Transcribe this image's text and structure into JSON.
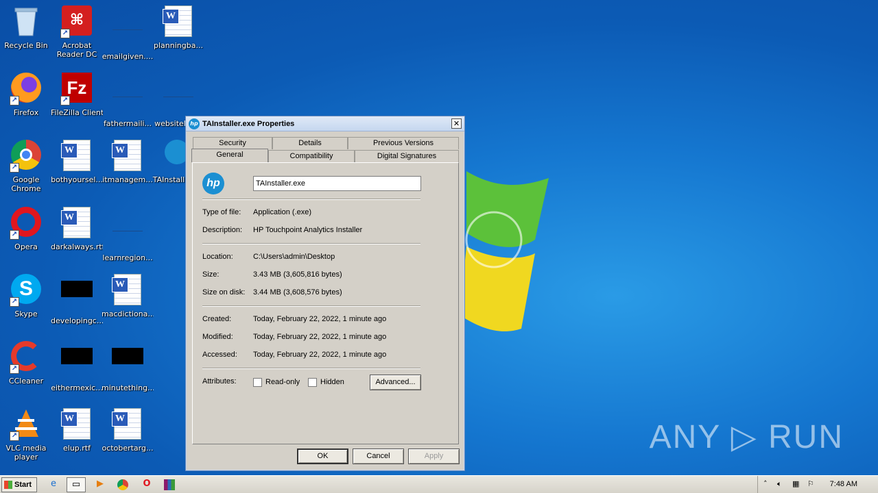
{
  "desktop": {
    "icons": [
      {
        "label": "Recycle Bin",
        "icon": "recycle-bin-icon"
      },
      {
        "label": "Acrobat Reader DC",
        "icon": "acrobat-reader-icon"
      },
      {
        "label": "emailgiven....",
        "icon": "blank-file-icon"
      },
      {
        "label": "planningba...",
        "icon": "word-document-icon"
      },
      {
        "label": "Firefox",
        "icon": "firefox-icon"
      },
      {
        "label": "FileZilla Client",
        "icon": "filezilla-icon"
      },
      {
        "label": "fathermaili...",
        "icon": "blank-file-icon"
      },
      {
        "label": "websitelea...",
        "icon": "blank-file-icon"
      },
      {
        "label": "Google Chrome",
        "icon": "chrome-icon"
      },
      {
        "label": "bothyoursel...",
        "icon": "word-document-icon"
      },
      {
        "label": "itmanagem...",
        "icon": "word-document-icon"
      },
      {
        "label": "TAInstall",
        "icon": "hp-installer-icon"
      },
      {
        "label": "Opera",
        "icon": "opera-icon"
      },
      {
        "label": "darkalways.rtf",
        "icon": "word-document-icon"
      },
      {
        "label": "learnregion...",
        "icon": "blank-file-icon"
      },
      {
        "label": "Skype",
        "icon": "skype-icon"
      },
      {
        "label": "developingc...",
        "icon": "black-file-icon"
      },
      {
        "label": "macdictiona...",
        "icon": "word-document-icon"
      },
      {
        "label": "CCleaner",
        "icon": "ccleaner-icon"
      },
      {
        "label": "eithermexic...",
        "icon": "black-file-icon"
      },
      {
        "label": "minutething...",
        "icon": "black-file-icon"
      },
      {
        "label": "VLC media player",
        "icon": "vlc-icon"
      },
      {
        "label": "elup.rtf",
        "icon": "word-document-icon"
      },
      {
        "label": "octobertarg...",
        "icon": "word-document-icon"
      }
    ],
    "watermark": "ANY ▷ RUN"
  },
  "dialog": {
    "title": "TAInstaller.exe Properties",
    "close_label": "✕",
    "tabs_top": [
      "Security",
      "Details",
      "Previous Versions"
    ],
    "tabs_bottom": [
      "General",
      "Compatibility",
      "Digital Signatures"
    ],
    "active_tab": "General",
    "general": {
      "file_name": "TAInstaller.exe",
      "type_label": "Type of file:",
      "type_value": "Application (.exe)",
      "description_label": "Description:",
      "description_value": "HP Touchpoint Analytics Installer",
      "location_label": "Location:",
      "location_value": "C:\\Users\\admin\\Desktop",
      "size_label": "Size:",
      "size_value": "3.43 MB (3,605,816 bytes)",
      "size_on_disk_label": "Size on disk:",
      "size_on_disk_value": "3.44 MB (3,608,576 bytes)",
      "created_label": "Created:",
      "created_value": "Today, February 22, 2022, 1 minute ago",
      "modified_label": "Modified:",
      "modified_value": "Today, February 22, 2022, 1 minute ago",
      "accessed_label": "Accessed:",
      "accessed_value": "Today, February 22, 2022, 1 minute ago",
      "attributes_label": "Attributes:",
      "readonly_label": "Read-only",
      "readonly_checked": false,
      "hidden_label": "Hidden",
      "hidden_checked": false,
      "advanced_label": "Advanced..."
    },
    "buttons": {
      "ok": "OK",
      "cancel": "Cancel",
      "apply": "Apply"
    }
  },
  "taskbar": {
    "start_label": "Start",
    "pinned": [
      "internet-explorer-icon",
      "file-explorer-icon",
      "media-player-icon",
      "chrome-icon",
      "opera-icon",
      "winrar-icon"
    ],
    "tray_icons": [
      "show-hidden-icons-chevron",
      "volume-icon",
      "network-icon",
      "action-center-flag-icon"
    ],
    "clock": "7:48 AM"
  }
}
